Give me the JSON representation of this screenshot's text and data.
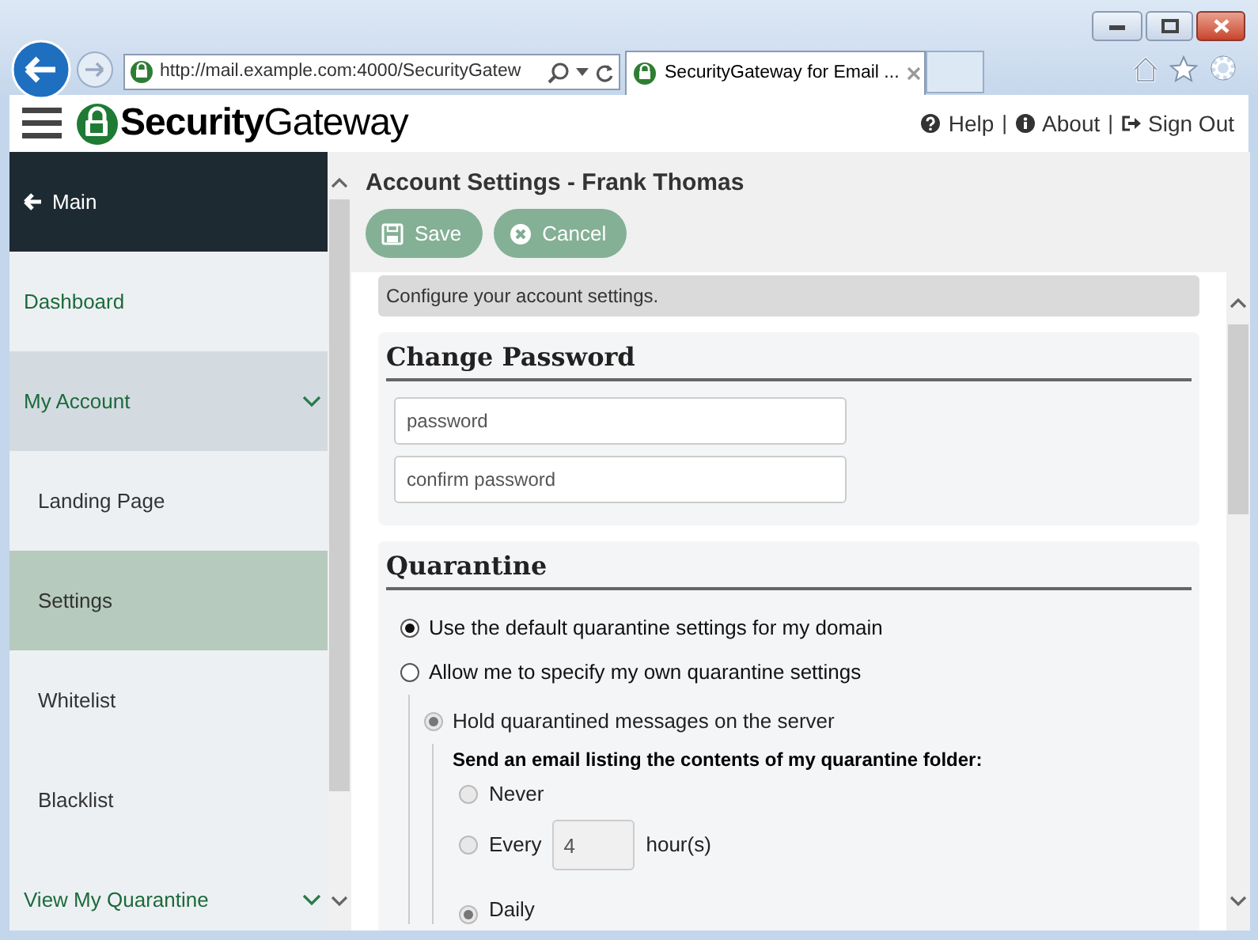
{
  "browser": {
    "address": "http://mail.example.com:4000/SecurityGatew",
    "tab_title": "SecurityGateway for Email ..."
  },
  "header": {
    "logo": "**Security**Gateway",
    "links": [
      {
        "kind": "help",
        "label": "Help"
      },
      {
        "kind": "about",
        "label": "About"
      },
      {
        "kind": "signout",
        "label": "Sign Out"
      }
    ],
    "separators": [
      "|",
      "|"
    ]
  },
  "sidebar": {
    "items": [
      {
        "kind": "back",
        "label": "Main",
        "selected": false
      },
      {
        "kind": "top",
        "label": "Dashboard",
        "selected": false
      },
      {
        "kind": "top",
        "label": "My Account",
        "selected": false,
        "expanded": true
      },
      {
        "kind": "sub",
        "label": "Landing Page",
        "selected": false
      },
      {
        "kind": "sub",
        "label": "Settings",
        "selected": true
      },
      {
        "kind": "sub",
        "label": "Whitelist",
        "selected": false
      },
      {
        "kind": "sub",
        "label": "Blacklist",
        "selected": false
      },
      {
        "kind": "top",
        "label": "View My Quarantine",
        "selected": false,
        "expanded": false
      }
    ]
  },
  "page": {
    "title": "Account Settings - Frank Thomas",
    "buttons": [
      {
        "kind": "save",
        "label": "Save"
      },
      {
        "kind": "cancel",
        "label": "Cancel"
      }
    ],
    "intro": "Configure your account settings."
  },
  "change_password": {
    "title": "Change Password",
    "fields": [
      {
        "placeholder": "password"
      },
      {
        "placeholder": "confirm password"
      }
    ]
  },
  "quarantine": {
    "title": "Quarantine",
    "options": [
      {
        "label": "Use the default quarantine settings for my domain",
        "selected": true,
        "disabled": false
      },
      {
        "label": "Allow me to specify my own quarantine settings",
        "selected": false,
        "disabled": false,
        "children": [
          {
            "label": "Hold quarantined messages on the server",
            "selected": true,
            "disabled": true,
            "notify": {
              "label": "Send an email listing the contents of my quarantine folder:",
              "options": [
                {
                  "kind": "plain",
                  "label": "Never",
                  "selected": false,
                  "disabled": true
                },
                {
                  "kind": "interval",
                  "label": "Every",
                  "value": "4",
                  "unit": "hour(s)",
                  "selected": false,
                  "disabled": true
                },
                {
                  "kind": "plain",
                  "label": "Daily",
                  "selected": true,
                  "disabled": true
                }
              ]
            }
          }
        ]
      }
    ]
  }
}
